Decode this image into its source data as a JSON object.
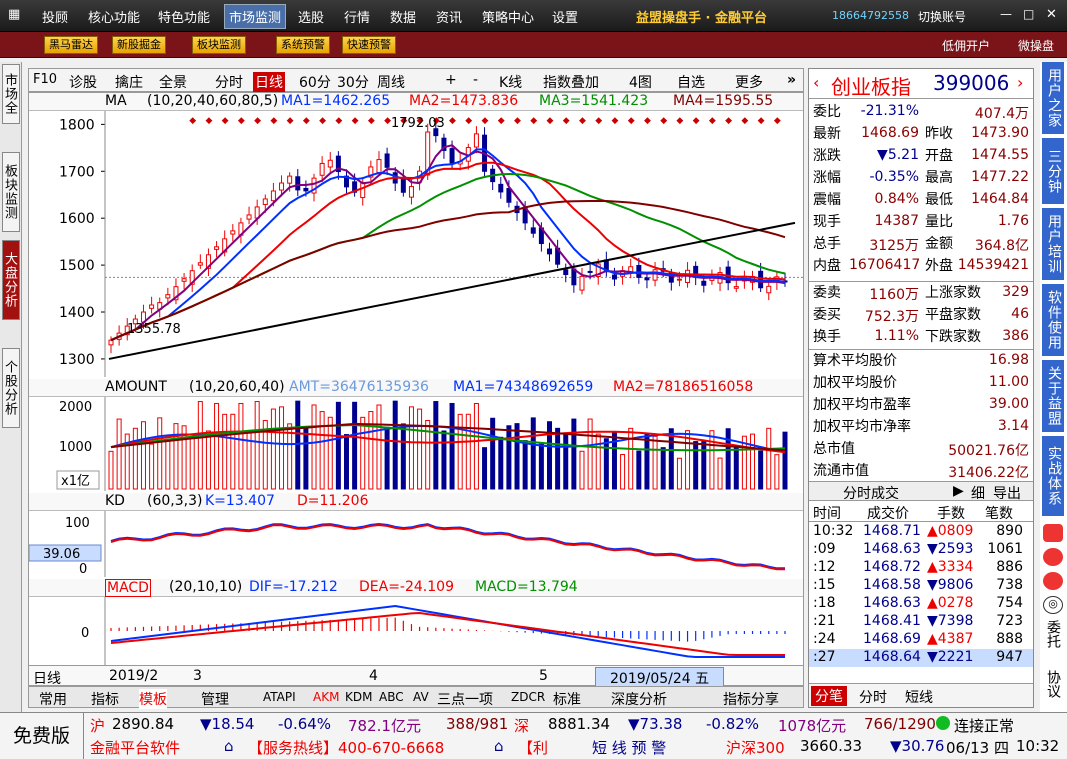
{
  "menu": {
    "items": [
      "投顾",
      "核心功能",
      "特色功能",
      "市场监测",
      "选股",
      "行情",
      "数据",
      "资讯",
      "策略中心",
      "设置"
    ],
    "brand": "益盟操盘手 · 金融平台",
    "phone": "18664792558",
    "switch_account": "切换账号"
  },
  "toolbar": {
    "buttons": [
      "黑马雷达",
      "新股掘金",
      "板块监测",
      "系统预警",
      "快速预警"
    ],
    "links": [
      "低佣开户",
      "微操盘"
    ]
  },
  "left_tabs": [
    "市场全景",
    "板块监测",
    "大盘分析",
    "个股分析"
  ],
  "chart_bar": {
    "items": [
      "F10",
      "诊股",
      "擒庄",
      "全景",
      "分时",
      "日线",
      "60分",
      "30分",
      "周线",
      "+",
      "-",
      "K线",
      "指数叠加",
      "4图",
      "自选",
      "更多",
      "»"
    ],
    "active": "日线"
  },
  "ma_header": {
    "name": "MA",
    "params": "(10,20,40,60,80,5)",
    "ma1": "MA1=1462.265",
    "ma2": "MA2=1473.836",
    "ma3": "MA3=1541.423",
    "ma4": "MA4=1595.55"
  },
  "price_axis": [
    "1800",
    "1700",
    "1600",
    "1500",
    "1400",
    "1300"
  ],
  "annotations": {
    "high": "1792.03",
    "low": "1355.78"
  },
  "amount_header": {
    "name": "AMOUNT",
    "params": "(10,20,60,40)",
    "amt": "AMT=36476135936",
    "ma1": "MA1=74348692659",
    "ma2": "MA2=78186516058"
  },
  "amount_axis": [
    "2000",
    "1000"
  ],
  "amount_unit": "x1亿",
  "kd_header": {
    "name": "KD",
    "params": "(60,3,3)",
    "k": "K=13.407",
    "d": "D=11.206"
  },
  "kd_axis": [
    "100",
    "0"
  ],
  "kd_cursor": "39.06",
  "macd_header": {
    "name": "MACD",
    "params": "(20,10,10)",
    "dif": "DIF=-17.212",
    "dea": "DEA=-24.109",
    "macd": "MACD=13.794"
  },
  "macd_axis": [
    "0"
  ],
  "date_axis": {
    "label": "日线",
    "ticks": [
      "2019/2",
      "3",
      "4",
      "5"
    ],
    "cursor": "2019/05/24 五"
  },
  "bottom_tabs": [
    "常用",
    "指标",
    "模板",
    "管理",
    "ATAPI",
    "AKM",
    "KDM",
    "ABC",
    "AV",
    "三点一项",
    "ZDCR",
    "标准",
    "深度分析",
    "指标分享"
  ],
  "quote": {
    "name": "创业板指",
    "code": "399006",
    "rows": [
      {
        "l": "委比",
        "v": "-21.31%",
        "l2": "",
        "v2": "407.4万"
      },
      {
        "l": "最新",
        "v": "1468.69",
        "l2": "昨收",
        "v2": "1473.90"
      },
      {
        "l": "涨跌",
        "v": "▼5.21",
        "l2": "开盘",
        "v2": "1474.55"
      },
      {
        "l": "涨幅",
        "v": "-0.35%",
        "l2": "最高",
        "v2": "1477.22"
      },
      {
        "l": "震幅",
        "v": "0.84%",
        "l2": "最低",
        "v2": "1464.84"
      },
      {
        "l": "现手",
        "v": "14387",
        "l2": "量比",
        "v2": "1.76"
      },
      {
        "l": "总手",
        "v": "3125万",
        "l2": "金额",
        "v2": "364.8亿"
      },
      {
        "l": "内盘",
        "v": "16706417",
        "l2": "外盘",
        "v2": "14539421"
      }
    ],
    "rows2": [
      {
        "l": "委卖",
        "v": "1160万",
        "l2": "上涨家数",
        "v2": "329"
      },
      {
        "l": "委买",
        "v": "752.3万",
        "l2": "平盘家数",
        "v2": "46"
      },
      {
        "l": "换手",
        "v": "1.11%",
        "l2": "下跌家数",
        "v2": "386"
      }
    ],
    "stats": [
      {
        "l": "算术平均股价",
        "v": "16.98"
      },
      {
        "l": "加权平均股价",
        "v": "11.00"
      },
      {
        "l": "加权平均市盈率",
        "v": "39.00"
      },
      {
        "l": "加权平均市净率",
        "v": "3.14"
      },
      {
        "l": "总市值",
        "v": "50021.76亿"
      },
      {
        "l": "流通市值",
        "v": "31406.22亿"
      }
    ]
  },
  "ticks": {
    "title": "分时成交",
    "detail": "细",
    "export": "导出",
    "headers": [
      "时间",
      "成交价",
      "手数",
      "笔数"
    ],
    "rows": [
      {
        "t": "10:32",
        "p": "1468.71",
        "d": "▲",
        "v": "0809",
        "n": "890"
      },
      {
        "t": ":09",
        "p": "1468.63",
        "d": "▼",
        "v": "2593",
        "n": "1061"
      },
      {
        "t": ":12",
        "p": "1468.72",
        "d": "▲",
        "v": "3334",
        "n": "886"
      },
      {
        "t": ":15",
        "p": "1468.58",
        "d": "▼",
        "v": "9806",
        "n": "738"
      },
      {
        "t": ":18",
        "p": "1468.63",
        "d": "▲",
        "v": "0278",
        "n": "754"
      },
      {
        "t": ":21",
        "p": "1468.41",
        "d": "▼",
        "v": "7398",
        "n": "723"
      },
      {
        "t": ":24",
        "p": "1468.69",
        "d": "▲",
        "v": "4387",
        "n": "888"
      },
      {
        "t": ":27",
        "p": "1468.64",
        "d": "▼",
        "v": "2221",
        "n": "947"
      }
    ],
    "tabs": [
      "分笔",
      "分时",
      "短线"
    ]
  },
  "right_tabs": [
    "用户之家",
    "三分钟",
    "用户培训",
    "软件使用",
    "关于益盟",
    "实战体系"
  ],
  "right_icons": [
    "委托",
    "协议"
  ],
  "status": {
    "free": "免费版",
    "sh": {
      "label": "沪",
      "price": "2890.84",
      "chg": "▼18.54",
      "pct": "-0.64%",
      "amt": "782.1亿元",
      "ratio": "388/981"
    },
    "sz": {
      "label": "深",
      "price": "8881.34",
      "chg": "▼73.38",
      "pct": "-0.82%",
      "amt": "1078亿元",
      "ratio": "766/1290"
    },
    "conn": "连接正常",
    "ticker": "金融平台软件",
    "hotline": "【服务热线】400-670-6668",
    "li": "【利",
    "alert": "短 线 预 警",
    "hs300": {
      "label": "沪深300",
      "price": "3660.33",
      "chg": "▼30.76"
    },
    "date": "06/13 四",
    "time": "10:32"
  }
}
